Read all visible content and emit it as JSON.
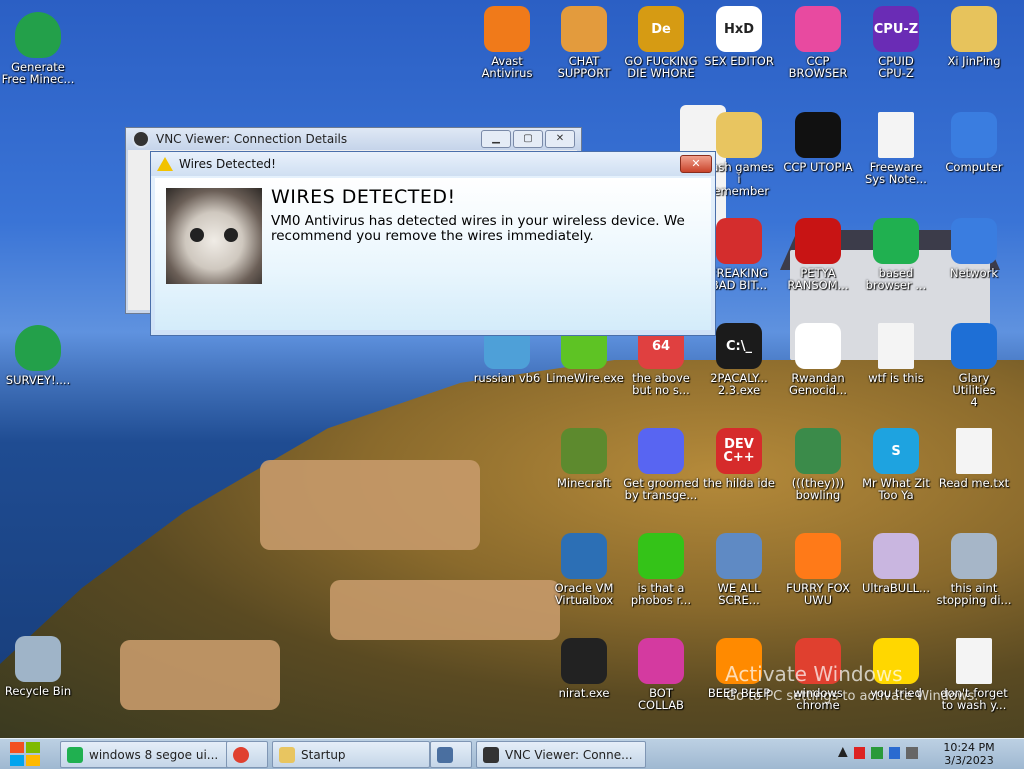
{
  "desktop": {
    "icons": [
      {
        "id": "generate",
        "label": "Generate\nFree Minec...",
        "icon": "shield-check-icon",
        "color": "#23a04a"
      },
      {
        "id": "survey",
        "label": "SURVEY!....",
        "icon": "shield-check-icon",
        "color": "#23a04a"
      },
      {
        "id": "recycle",
        "label": "Recycle Bin",
        "icon": "recycle-bin-icon",
        "color": "#9fb4c8"
      },
      {
        "id": "avast",
        "label": "Avast\nAntivirus",
        "icon": "avast-icon",
        "color": "#f07a1a"
      },
      {
        "id": "chat",
        "label": "CHAT\nSUPPORT",
        "icon": "support-person-icon",
        "color": "#e39b3d"
      },
      {
        "id": "gofd",
        "label": "GO FUCKING\nDIE WHORE",
        "icon": "de-icon",
        "color": "#d69b13",
        "glyph": "De"
      },
      {
        "id": "sexeditor",
        "label": "SEX EDITOR",
        "icon": "hxd-icon",
        "color": "#ffffff",
        "glyph": "HxD"
      },
      {
        "id": "ccpbrowser",
        "label": "CCP\nBROWSER",
        "icon": "browser-icon",
        "color": "#e84aa0"
      },
      {
        "id": "cpuid",
        "label": "CPUID\nCPU-Z",
        "icon": "cpuz-icon",
        "color": "#6a2cb5",
        "glyph": "CPU-Z"
      },
      {
        "id": "xijinping",
        "label": "Xi JinPing",
        "icon": "folder-user-icon",
        "color": "#e7c35c"
      },
      {
        "id": "flash",
        "label": "flash games i\nremember",
        "icon": "folder-icon",
        "color": "#e8c560"
      },
      {
        "id": "ccputopia",
        "label": "CCP UTOPIA",
        "icon": "dark-logo-icon",
        "color": "#111111"
      },
      {
        "id": "freeware",
        "label": "Freeware\nSys Note...",
        "icon": "document-icon",
        "color": "#f4f4f4"
      },
      {
        "id": "computer",
        "label": "Computer",
        "icon": "computer-icon",
        "color": "#3a7de0"
      },
      {
        "id": "freaking",
        "label": "FREAKING\nBAD BIT...",
        "icon": "angry-bird-icon",
        "color": "#d42d2d"
      },
      {
        "id": "petya",
        "label": "PETYA\nRANSOM...",
        "icon": "skull-red-icon",
        "color": "#c81414"
      },
      {
        "id": "based",
        "label": "based\nbrowser ...",
        "icon": "chat-green-icon",
        "color": "#20b050"
      },
      {
        "id": "network",
        "label": "Network",
        "icon": "network-icon",
        "color": "#3a7de0"
      },
      {
        "id": "russianvb6",
        "label": "russian vb6",
        "icon": "vb6-icon",
        "color": "#4ea0d8"
      },
      {
        "id": "limewire",
        "label": "LimeWire.exe",
        "icon": "limewire-icon",
        "color": "#5ec324"
      },
      {
        "id": "above",
        "label": "the above\nbut no s...",
        "icon": "text-64-icon",
        "color": "#e04040",
        "glyph": "64"
      },
      {
        "id": "2pacaly",
        "label": "2PACALY...\n2.3.exe",
        "icon": "cmd-icon",
        "color": "#1b1b1b",
        "glyph": "C:\\_"
      },
      {
        "id": "rwandan",
        "label": "Rwandan\nGenocid...",
        "icon": "troll-face-icon",
        "color": "#ffffff"
      },
      {
        "id": "wtf",
        "label": "wtf is this",
        "icon": "ini-file-icon",
        "color": "#f4f4f4"
      },
      {
        "id": "glary",
        "label": "Glary Utilities\n4",
        "icon": "glary-icon",
        "color": "#1e6fd6"
      },
      {
        "id": "minecraft",
        "label": "Minecraft",
        "icon": "grass-block-icon",
        "color": "#5d8a2e"
      },
      {
        "id": "groomed",
        "label": "Get groomed\nby transge...",
        "icon": "discord-icon",
        "color": "#5865f2"
      },
      {
        "id": "hilda",
        "label": "the hilda ide",
        "icon": "devcpp-icon",
        "color": "#d62b2b",
        "glyph": "DEV\nC++"
      },
      {
        "id": "bowling",
        "label": "(((they)))\nbowling",
        "icon": "bowling-icon",
        "color": "#3b8b4a"
      },
      {
        "id": "mrwhat",
        "label": "Mr What Zit\nToo Ya",
        "icon": "skype-icon",
        "color": "#1ea3e0",
        "glyph": "S"
      },
      {
        "id": "readme",
        "label": "Read me.txt",
        "icon": "text-file-icon",
        "color": "#f4f4f4"
      },
      {
        "id": "oraclevm",
        "label": "Oracle VM\nVirtualbox",
        "icon": "virtualbox-icon",
        "color": "#2c6fb5"
      },
      {
        "id": "phobos",
        "label": "is that a\nphobos r...",
        "icon": "icq-icon",
        "color": "#34c318"
      },
      {
        "id": "weall",
        "label": "WE ALL\nSCRE...",
        "icon": "pc-icon",
        "color": "#5f8ac4"
      },
      {
        "id": "furryfox",
        "label": "FURRY FOX\nUWU",
        "icon": "firefox-icon",
        "color": "#ff7a18"
      },
      {
        "id": "ultrabull",
        "label": "UltraBULL...",
        "icon": "disc-icon",
        "color": "#c9b6e0"
      },
      {
        "id": "thisaint",
        "label": "this aint\nstopping di...",
        "icon": "printer-icon",
        "color": "#a6b6c8"
      },
      {
        "id": "nirat",
        "label": "nirat.exe",
        "icon": "skull-icon",
        "color": "#222222"
      },
      {
        "id": "botcollab",
        "label": "BOT\nCOLLAB",
        "icon": "monitor-pink-icon",
        "color": "#d43aa0"
      },
      {
        "id": "beepbeep",
        "label": "BEEP BEEP",
        "icon": "vlc-icon",
        "color": "#ff8a00"
      },
      {
        "id": "chrome",
        "label": "windows\nchrome",
        "icon": "chrome-icon",
        "color": "#e0402f"
      },
      {
        "id": "star",
        "label": "you tried",
        "icon": "star-icon",
        "color": "#ffd700"
      },
      {
        "id": "forget",
        "label": "don't forget\nto wash y...",
        "icon": "ini-file-icon",
        "color": "#f4f4f4"
      }
    ],
    "watermark": {
      "title": "Activate Windows",
      "subtitle": "Go to PC settings to activate Windows."
    }
  },
  "vnc_window": {
    "title": "VNC Viewer: Connection Details"
  },
  "dialog": {
    "title": "Wires Detected!",
    "heading": "WIRES DETECTED!",
    "message": "VM0 Antivirus has detected wires in your wireless device. We recommend you remove the wires immediately.",
    "close": "✕"
  },
  "taskbar": {
    "items": [
      {
        "label": "windows 8 segoe ui...",
        "icon": "chat-green-icon",
        "color": "#20b050"
      },
      {
        "label": "",
        "icon": "chrome-icon",
        "color": "#e0402f"
      },
      {
        "label": "Startup",
        "icon": "folder-icon",
        "color": "#e8c560"
      },
      {
        "label": "",
        "icon": "tool-icon",
        "color": "#4a6fa0"
      },
      {
        "label": "VNC Viewer: Conne...",
        "icon": "vnc-icon",
        "color": "#333333"
      }
    ],
    "time": "10:24 PM",
    "date": "3/3/2023"
  },
  "colors": {
    "accent": "#3a74d6",
    "dialog_border": "#4a6faa",
    "close_red": "#c9442b"
  }
}
